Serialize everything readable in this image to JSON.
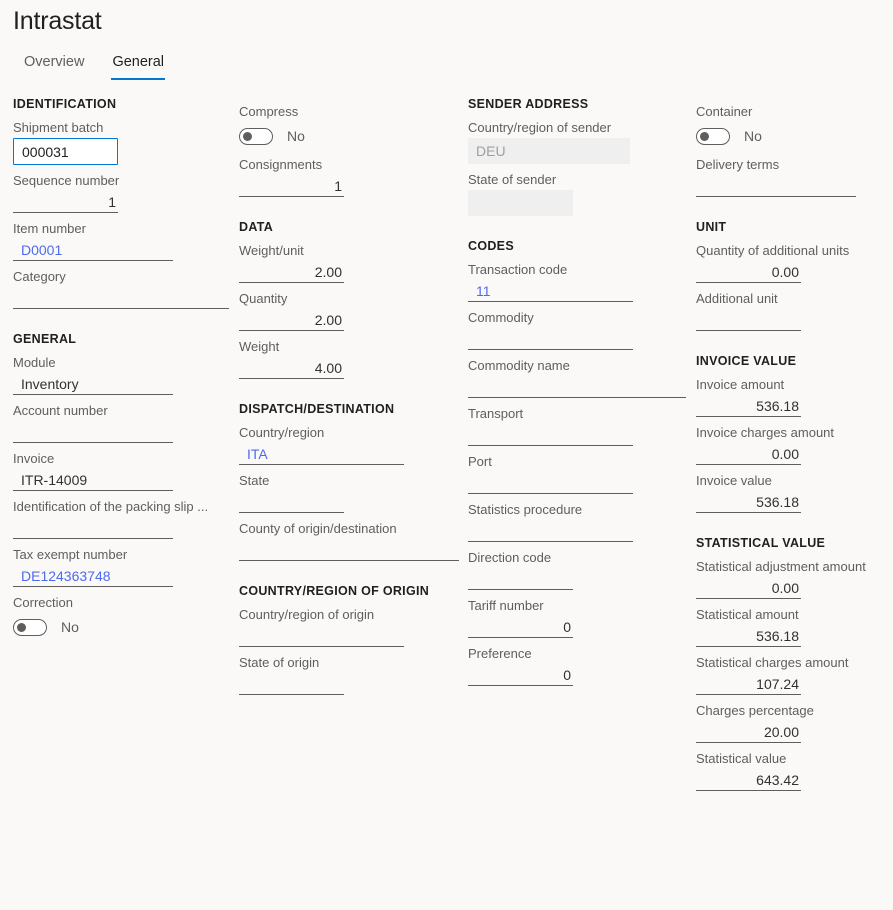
{
  "header": {
    "title": "Intrastat"
  },
  "tabs": [
    {
      "label": "Overview",
      "active": false
    },
    {
      "label": "General",
      "active": true
    }
  ],
  "accent_color": "#0078d4",
  "link_color": "#4f6bed",
  "background_color": "#faf9f8",
  "columns": {
    "col1": {
      "groups": [
        {
          "heading": "IDENTIFICATION",
          "fields": [
            {
              "label": "Shipment batch",
              "value": "000031",
              "type": "input-focused"
            },
            {
              "label": "Sequence number",
              "value": "1",
              "type": "number"
            },
            {
              "label": "Item number",
              "value": "D0001",
              "type": "link"
            },
            {
              "label": "Category",
              "value": "",
              "type": "text-wide"
            }
          ]
        },
        {
          "heading": "GENERAL",
          "fields": [
            {
              "label": "Module",
              "value": "Inventory",
              "type": "text"
            },
            {
              "label": "Account number",
              "value": "",
              "type": "text"
            },
            {
              "label": "Invoice",
              "value": "ITR-14009",
              "type": "text"
            },
            {
              "label": "Identification of the packing slip ...",
              "value": "",
              "type": "text"
            },
            {
              "label": "Tax exempt number",
              "value": "DE124363748",
              "type": "link"
            },
            {
              "label": "Correction",
              "value": "No",
              "type": "toggle"
            }
          ]
        }
      ]
    },
    "col2": {
      "groups": [
        {
          "heading": "",
          "fields": [
            {
              "label": "Compress",
              "value": "No",
              "type": "toggle"
            },
            {
              "label": "Consignments",
              "value": "1",
              "type": "number"
            }
          ]
        },
        {
          "heading": "DATA",
          "fields": [
            {
              "label": "Weight/unit",
              "value": "2.00",
              "type": "number"
            },
            {
              "label": "Quantity",
              "value": "2.00",
              "type": "number"
            },
            {
              "label": "Weight",
              "value": "4.00",
              "type": "number"
            }
          ]
        },
        {
          "heading": "DISPATCH/DESTINATION",
          "fields": [
            {
              "label": "Country/region",
              "value": "ITA",
              "type": "link"
            },
            {
              "label": "State",
              "value": "",
              "type": "text-narrow"
            },
            {
              "label": "County of origin/destination",
              "value": "",
              "type": "text-wide"
            }
          ]
        },
        {
          "heading": "COUNTRY/REGION OF ORIGIN",
          "fields": [
            {
              "label": "Country/region of origin",
              "value": "",
              "type": "text"
            },
            {
              "label": "State of origin",
              "value": "",
              "type": "text-narrow"
            }
          ]
        }
      ]
    },
    "col3": {
      "groups": [
        {
          "heading": "SENDER ADDRESS",
          "fields": [
            {
              "label": "Country/region of sender",
              "value": "DEU",
              "type": "readonly-wide"
            },
            {
              "label": "State of sender",
              "value": "",
              "type": "readonly-narrow"
            }
          ]
        },
        {
          "heading": "CODES",
          "fields": [
            {
              "label": "Transaction code",
              "value": "11",
              "type": "link"
            },
            {
              "label": "Commodity",
              "value": "",
              "type": "text"
            },
            {
              "label": "Commodity name",
              "value": "",
              "type": "text-wide"
            },
            {
              "label": "Transport",
              "value": "",
              "type": "text"
            },
            {
              "label": "Port",
              "value": "",
              "type": "text"
            },
            {
              "label": "Statistics procedure",
              "value": "",
              "type": "text"
            },
            {
              "label": "Direction code",
              "value": "",
              "type": "text-narrow"
            },
            {
              "label": "Tariff number",
              "value": "0",
              "type": "number"
            },
            {
              "label": "Preference",
              "value": "0",
              "type": "number"
            }
          ]
        }
      ]
    },
    "col4": {
      "groups": [
        {
          "heading": "",
          "fields": [
            {
              "label": "Container",
              "value": "No",
              "type": "toggle"
            },
            {
              "label": "Delivery terms",
              "value": "",
              "type": "text-wide"
            }
          ]
        },
        {
          "heading": "UNIT",
          "fields": [
            {
              "label": "Quantity of additional units",
              "value": "0.00",
              "type": "number"
            },
            {
              "label": "Additional unit",
              "value": "",
              "type": "text"
            }
          ]
        },
        {
          "heading": "INVOICE VALUE",
          "fields": [
            {
              "label": "Invoice amount",
              "value": "536.18",
              "type": "number"
            },
            {
              "label": "Invoice charges amount",
              "value": "0.00",
              "type": "number"
            },
            {
              "label": "Invoice value",
              "value": "536.18",
              "type": "number"
            }
          ]
        },
        {
          "heading": "STATISTICAL VALUE",
          "fields": [
            {
              "label": "Statistical adjustment amount",
              "value": "0.00",
              "type": "number"
            },
            {
              "label": "Statistical amount",
              "value": "536.18",
              "type": "number"
            },
            {
              "label": "Statistical charges amount",
              "value": "107.24",
              "type": "number"
            },
            {
              "label": "Charges percentage",
              "value": "20.00",
              "type": "number"
            },
            {
              "label": "Statistical value",
              "value": "643.42",
              "type": "number"
            }
          ]
        }
      ]
    }
  }
}
